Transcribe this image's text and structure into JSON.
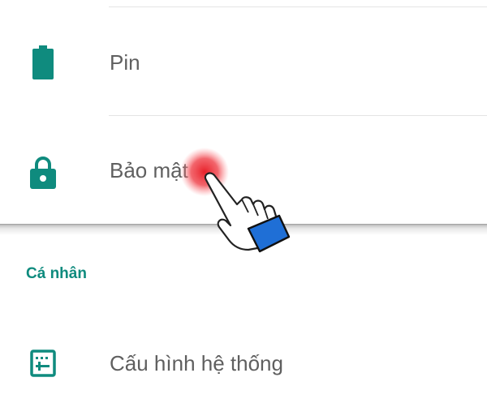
{
  "settings": {
    "items": [
      {
        "label": "Pin",
        "icon": "battery-icon"
      },
      {
        "label": "Bảo mật",
        "icon": "lock-icon"
      }
    ],
    "personal_section": {
      "header": "Cá nhân",
      "items": [
        {
          "label": "Cấu hình hệ thống",
          "icon": "system-config-icon"
        }
      ]
    }
  },
  "colors": {
    "accent": "#0f8b7e",
    "tap_indicator": "#e8212a",
    "cursor_cuff": "#1f6fd6"
  }
}
